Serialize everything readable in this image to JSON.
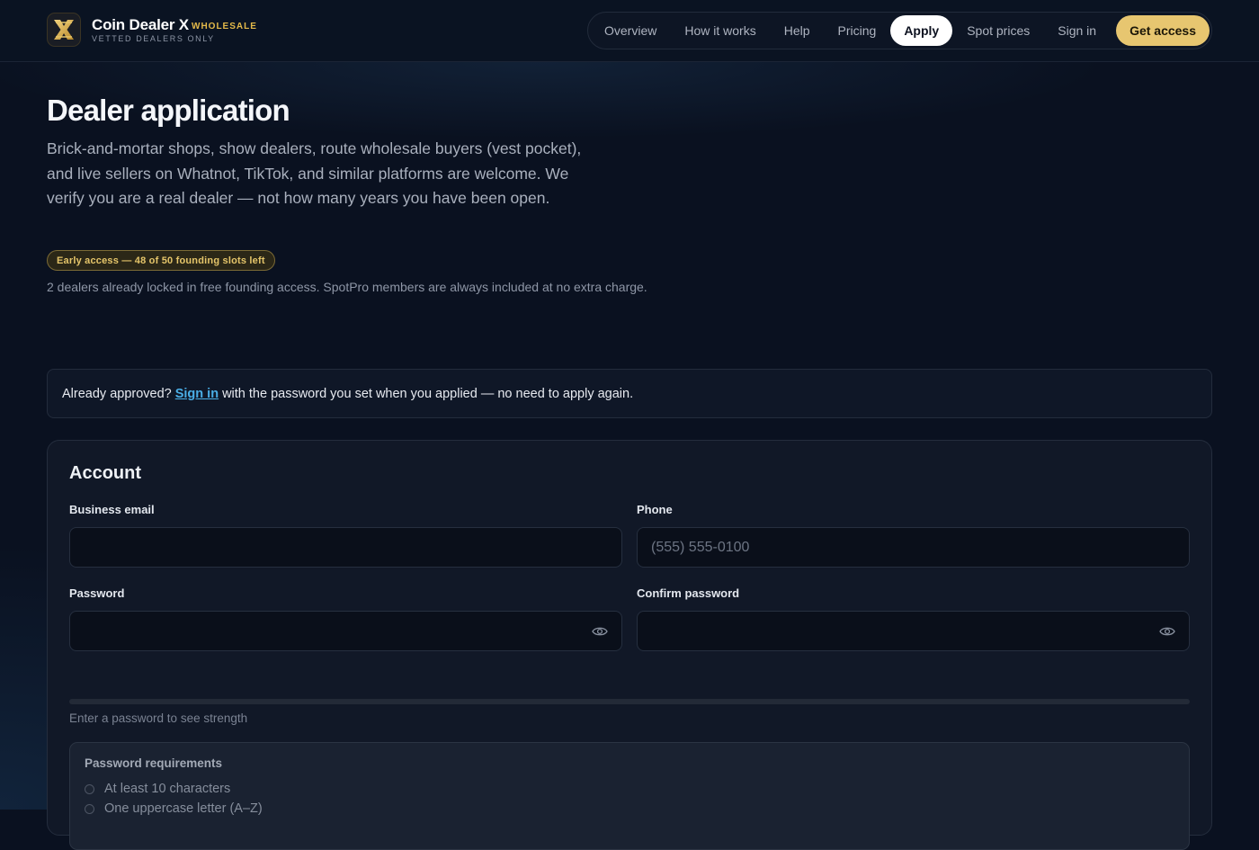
{
  "header": {
    "brand_name": "Coin Dealer X",
    "brand_tag": "WHOLESALE",
    "brand_sub": "VETTED DEALERS ONLY",
    "nav": [
      {
        "label": "Overview"
      },
      {
        "label": "How it works"
      },
      {
        "label": "Help"
      },
      {
        "label": "Pricing"
      },
      {
        "label": "Apply",
        "active": true
      },
      {
        "label": "Spot prices"
      },
      {
        "label": "Sign in"
      },
      {
        "label": "Get access"
      }
    ]
  },
  "hero": {
    "title": "Dealer application",
    "intro": "Brick-and-mortar shops, show dealers, route wholesale buyers (vest pocket), and live sellers on Whatnot, TikTok, and similar platforms are welcome. We verify you are a real dealer — not how many years you have been open.",
    "badge": "Early access — 48 of 50 founding slots left",
    "founding_note": "2 dealers already locked in free founding access. SpotPro members are always included at no extra charge."
  },
  "approved": {
    "prefix": "Already approved?",
    "link": "Sign in",
    "suffix": "with the password you set when you applied — no need to apply again."
  },
  "account": {
    "title": "Account",
    "email_label": "Business email",
    "email_value": "",
    "phone_label": "Phone",
    "phone_placeholder": "(555) 555-0100",
    "password_label": "Password",
    "confirm_label": "Confirm password",
    "strength_text": "Enter a password to see strength",
    "strength_level": 0,
    "requirements_title": "Password requirements",
    "requirements": [
      "At least 10 characters",
      "One uppercase letter (A–Z)"
    ]
  },
  "colors": {
    "accent_gold": "#e7c670",
    "link_blue": "#4aaee6",
    "background": "#0a1120"
  },
  "icons": {
    "logo": "x-logo-icon",
    "password_toggle": "eye-icon"
  }
}
